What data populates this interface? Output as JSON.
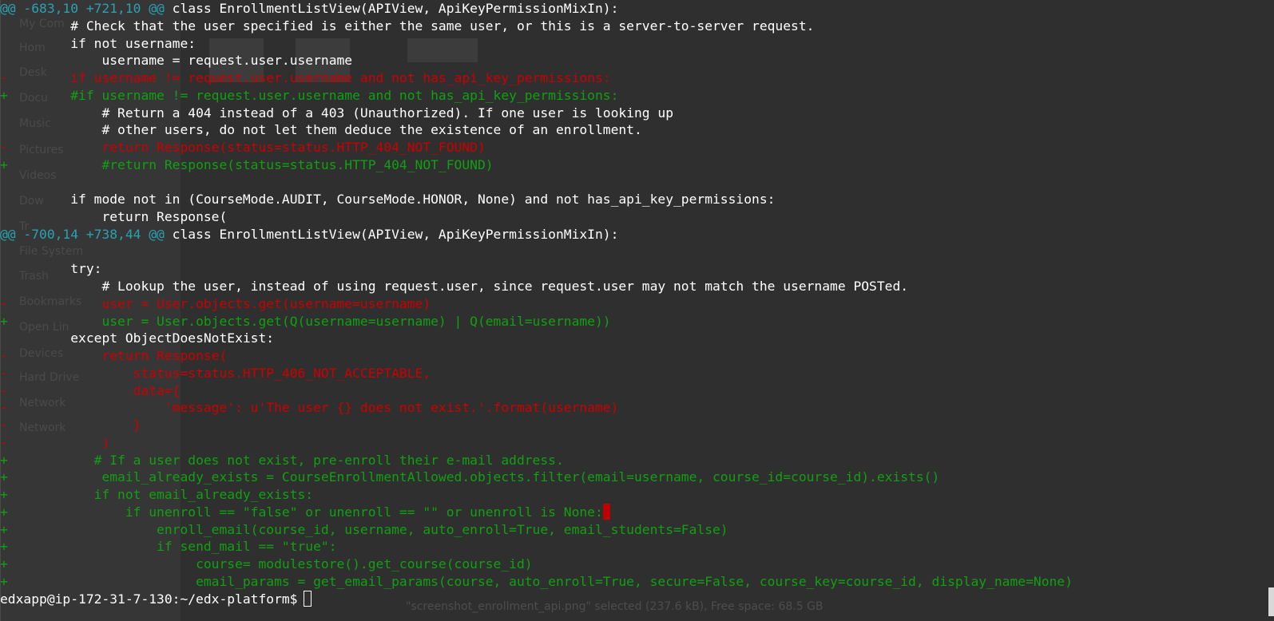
{
  "background": {
    "sidebar_items": [
      "My Com",
      "Hom",
      "Desk",
      "Docu",
      "Music",
      "Pictures",
      "Videos",
      "Dow",
      "Tr",
      "File System",
      "Trash",
      "Bookmarks",
      "Open Lin",
      "Devices",
      "Hard Drive",
      "Network",
      "Network"
    ],
    "status_text": "\"screenshot_enrollment_api.png\" selected (237.6 kB), Free space: 68.5 GB"
  },
  "terminal": {
    "lines": [
      {
        "type": "hunk",
        "marker": "",
        "at": "@@ -683,10 +721,10 @@",
        "text": " class EnrollmentListView(APIView, ApiKeyPermissionMixIn):"
      },
      {
        "type": "ctx",
        "marker": " ",
        "text": "        # Check that the user specified is either the same user, or this is a server-to-server request."
      },
      {
        "type": "ctx",
        "marker": " ",
        "text": "        if not username:"
      },
      {
        "type": "ctx",
        "marker": " ",
        "text": "            username = request.user.username"
      },
      {
        "type": "del",
        "marker": "-",
        "text": "        if username != request.user.username and not has_api_key_permissions:"
      },
      {
        "type": "add",
        "marker": "+",
        "text": "        #if username != request.user.username and not has_api_key_permissions:"
      },
      {
        "type": "ctx",
        "marker": " ",
        "text": "            # Return a 404 instead of a 403 (Unauthorized). If one user is looking up"
      },
      {
        "type": "ctx",
        "marker": " ",
        "text": "            # other users, do not let them deduce the existence of an enrollment."
      },
      {
        "type": "del",
        "marker": "-",
        "text": "            return Response(status=status.HTTP_404_NOT_FOUND)"
      },
      {
        "type": "add",
        "marker": "+",
        "text": "            #return Response(status=status.HTTP_404_NOT_FOUND)"
      },
      {
        "type": "ctx",
        "marker": " ",
        "text": ""
      },
      {
        "type": "ctx",
        "marker": " ",
        "text": "        if mode not in (CourseMode.AUDIT, CourseMode.HONOR, None) and not has_api_key_permissions:"
      },
      {
        "type": "ctx",
        "marker": " ",
        "text": "            return Response("
      },
      {
        "type": "hunk",
        "marker": "",
        "at": "@@ -700,14 +738,44 @@",
        "text": " class EnrollmentListView(APIView, ApiKeyPermissionMixIn):"
      },
      {
        "type": "ctx",
        "marker": " ",
        "text": ""
      },
      {
        "type": "ctx",
        "marker": " ",
        "text": "        try:"
      },
      {
        "type": "ctx",
        "marker": " ",
        "text": "            # Lookup the user, instead of using request.user, since request.user may not match the username POSTed."
      },
      {
        "type": "del",
        "marker": "-",
        "text": "            user = User.objects.get(username=username)"
      },
      {
        "type": "add",
        "marker": "+",
        "text": "            user = User.objects.get(Q(username=username) | Q(email=username))"
      },
      {
        "type": "ctx",
        "marker": " ",
        "text": "        except ObjectDoesNotExist:"
      },
      {
        "type": "del",
        "marker": "-",
        "text": "            return Response("
      },
      {
        "type": "del",
        "marker": "-",
        "text": "                status=status.HTTP_406_NOT_ACCEPTABLE,"
      },
      {
        "type": "del",
        "marker": "-",
        "text": "                data={"
      },
      {
        "type": "del",
        "marker": "-",
        "text": "                    'message': u'The user {} does not exist.'.format(username)"
      },
      {
        "type": "del",
        "marker": "-",
        "text": "                }"
      },
      {
        "type": "del",
        "marker": "-",
        "text": "            )"
      },
      {
        "type": "add",
        "marker": "+",
        "text": "           # If a user does not exist, pre-enroll their e-mail address."
      },
      {
        "type": "add",
        "marker": "+",
        "text": "            email_already_exists = CourseEnrollmentAllowed.objects.filter(email=username, course_id=course_id).exists()"
      },
      {
        "type": "add",
        "marker": "+",
        "text": "           if not email_already_exists:"
      },
      {
        "type": "add",
        "marker": "+",
        "text": "               if unenroll == \"false\" or unenroll == \"\" or unenroll is None:",
        "cursor": true
      },
      {
        "type": "add",
        "marker": "+",
        "text": "                   enroll_email(course_id, username, auto_enroll=True, email_students=False)"
      },
      {
        "type": "add",
        "marker": "+",
        "text": "                   if send_mail == \"true\":"
      },
      {
        "type": "add",
        "marker": "+",
        "text": "                        course= modulestore().get_course(course_id)"
      },
      {
        "type": "add",
        "marker": "+",
        "text": "                        email_params = get_email_params(course, auto_enroll=True, secure=False, course_key=course_id, display_name=None)"
      }
    ],
    "prompt": "edxapp@ip-172-31-7-130:~/edx-platform$"
  },
  "colors": {
    "added": "#11a011",
    "removed": "#cc0000",
    "hunk_header": "#2aa1b3",
    "context": "#ffffff",
    "background": "#2f2f2f"
  }
}
